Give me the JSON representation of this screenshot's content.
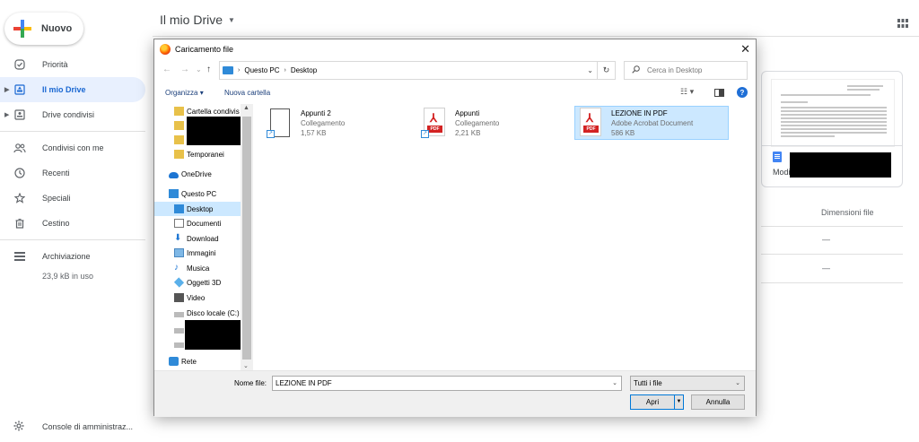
{
  "drive": {
    "new_label": "Nuovo",
    "title": "Il mio Drive",
    "nav": [
      {
        "label": "Priorità",
        "icon": "check-circle-icon"
      },
      {
        "label": "Il mio Drive",
        "icon": "my-drive-icon"
      },
      {
        "label": "Drive condivisi",
        "icon": "shared-drives-icon"
      },
      {
        "label": "Condivisi con me",
        "icon": "people-icon"
      },
      {
        "label": "Recenti",
        "icon": "clock-icon"
      },
      {
        "label": "Speciali",
        "icon": "star-icon"
      },
      {
        "label": "Cestino",
        "icon": "trash-icon"
      },
      {
        "label": "Archiviazione",
        "icon": "storage-icon"
      }
    ],
    "storage_used": "23,9 kB in uso",
    "admin_label": "Console di amministraz...",
    "preview_name": "Modi",
    "column_header": "Dimensioni file",
    "row_values": [
      "—",
      "—"
    ]
  },
  "dialog": {
    "title": "Caricamento file",
    "breadcrumb": [
      "Questo PC",
      "Desktop"
    ],
    "search_placeholder": "Cerca in Desktop",
    "organize_label": "Organizza",
    "new_folder_label": "Nuova cartella",
    "tree": [
      {
        "label": "Cartella condivis",
        "icon": "shortcut-folder-icon"
      },
      {
        "label": "",
        "icon": "shortcut-folder-icon"
      },
      {
        "label": "",
        "icon": "shortcut-folder-icon"
      },
      {
        "label": "Temporanei",
        "icon": "shortcut-folder-icon"
      },
      {
        "label": "OneDrive",
        "icon": "cloud-icon"
      },
      {
        "label": "Questo PC",
        "icon": "computer-icon"
      },
      {
        "label": "Desktop",
        "icon": "desktop-icon"
      },
      {
        "label": "Documenti",
        "icon": "documents-icon"
      },
      {
        "label": "Download",
        "icon": "download-icon"
      },
      {
        "label": "Immagini",
        "icon": "pictures-icon"
      },
      {
        "label": "Musica",
        "icon": "music-icon"
      },
      {
        "label": "Oggetti 3D",
        "icon": "objects-3d-icon"
      },
      {
        "label": "Video",
        "icon": "video-icon"
      },
      {
        "label": "Disco locale (C:)",
        "icon": "drive-icon"
      },
      {
        "label": "",
        "icon": "drive-icon"
      },
      {
        "label": "",
        "icon": "drive-icon"
      },
      {
        "label": "Rete",
        "icon": "network-icon"
      }
    ],
    "files": [
      {
        "name": "Appunti 2",
        "type": "Collegamento",
        "size": "1,57 KB",
        "icon": "blank-shortcut-icon"
      },
      {
        "name": "Appunti",
        "type": "Collegamento",
        "size": "2,21 KB",
        "icon": "pdf-shortcut-icon"
      },
      {
        "name": "LEZIONE IN PDF",
        "type": "Adobe Acrobat Document",
        "size": "586 KB",
        "icon": "pdf-icon"
      }
    ],
    "pdf_tag": "PDF",
    "filename_label": "Nome file:",
    "filename_value": "LEZIONE IN PDF",
    "filter_value": "Tutti i file",
    "open_label": "Apri",
    "cancel_label": "Annulla"
  }
}
